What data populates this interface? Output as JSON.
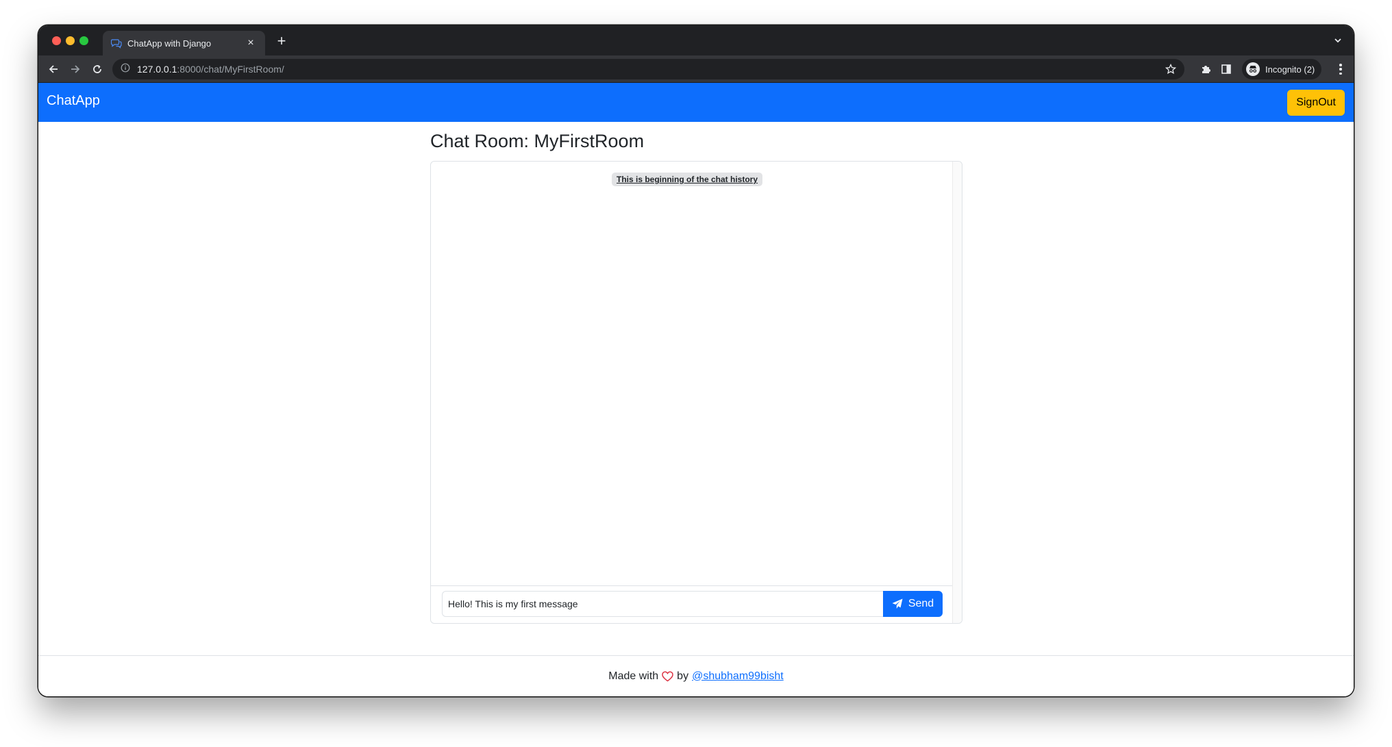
{
  "browser": {
    "tab_title": "ChatApp with Django",
    "url_host": "127.0.0.1",
    "url_path": ":8000/chat/MyFirstRoom/",
    "incognito_label": "Incognito (2)",
    "new_tab_symbol": "+",
    "close_symbol": "×"
  },
  "navbar": {
    "brand": "ChatApp",
    "signout_label": "SignOut",
    "color": "#0d6efd",
    "signout_color": "#ffc107"
  },
  "chat": {
    "heading": "Chat Room: MyFirstRoom",
    "history_label": "This is beginning of the chat history",
    "message_value": "Hello! This is my first message",
    "send_label": "Send"
  },
  "footer": {
    "made_with": "Made with",
    "by": "by",
    "author": "@shubham99bisht"
  },
  "icons": {
    "tab": "chat-bubbles-icon",
    "heart": "heart-icon",
    "send": "paper-plane-icon"
  }
}
